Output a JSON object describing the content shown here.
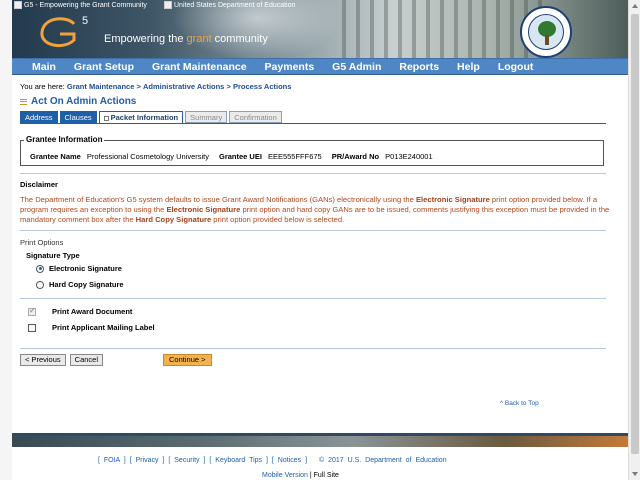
{
  "header": {
    "broken_img_1": "G5 - Empowering the Grant Community",
    "broken_img_2": "United States Department of Education",
    "logo_text": "G5",
    "tagline_pre": "Empowering the ",
    "tagline_hl": "grant",
    "tagline_post": " community"
  },
  "nav": [
    "Main",
    "Grant Setup",
    "Grant Maintenance",
    "Payments",
    "G5 Admin",
    "Reports",
    "Help",
    "Logout"
  ],
  "breadcrumb": {
    "prefix": "You are here:",
    "items": [
      "Grant Maintenance",
      "Administrative Actions",
      "Process Actions"
    ]
  },
  "page_title": "Act On Admin Actions",
  "tabs": {
    "address": "Address",
    "clauses": "Clauses",
    "packet": "Packet Information",
    "summary": "Summary",
    "confirmation": "Confirmation"
  },
  "grantee": {
    "legend": "Grantee Information",
    "name_label": "Grantee Name",
    "name_value": "Professional Cosmetology University",
    "uei_label": "Grantee UEI",
    "uei_value": "EEE555FFF675",
    "award_label": "PR/Award No",
    "award_value": "P013E240001"
  },
  "disclaimer": {
    "heading": "Disclaimer",
    "p1": "The Department of Education's G5 system defaults to issue Grant Award Notifications (GANs) electronically using the ",
    "b1": "Electronic Signature",
    "p2": " print option provided below. If a program requires an exception to using the ",
    "b2": "Electronic Signature",
    "p3": " print option and hard copy GANs are to be issued, comments justifying this exception must be provided in the mandatory comment box after the ",
    "b3": "Hard Copy Signature",
    "p4": " print option provided below is selected."
  },
  "print_options": {
    "label": "Print Options",
    "signature_type": "Signature Type",
    "electronic": "Electronic Signature",
    "hard_copy": "Hard Copy Signature",
    "print_award": "Print Award Document",
    "print_mailing": "Print Applicant Mailing Label"
  },
  "buttons": {
    "previous": "< Previous",
    "cancel": "Cancel",
    "continue": "Continue >"
  },
  "back_to_top": "^ Back to Top",
  "footer": {
    "links": [
      "[ FOIA ]",
      "[ Privacy ]",
      "[ Security ]",
      "[ Keyboard Tips ]",
      "[ Notices ]"
    ],
    "copyright": "© 2017 U.S. Department of Education",
    "mobile": "Mobile Version",
    "divider": " | ",
    "full": "Full Site"
  }
}
